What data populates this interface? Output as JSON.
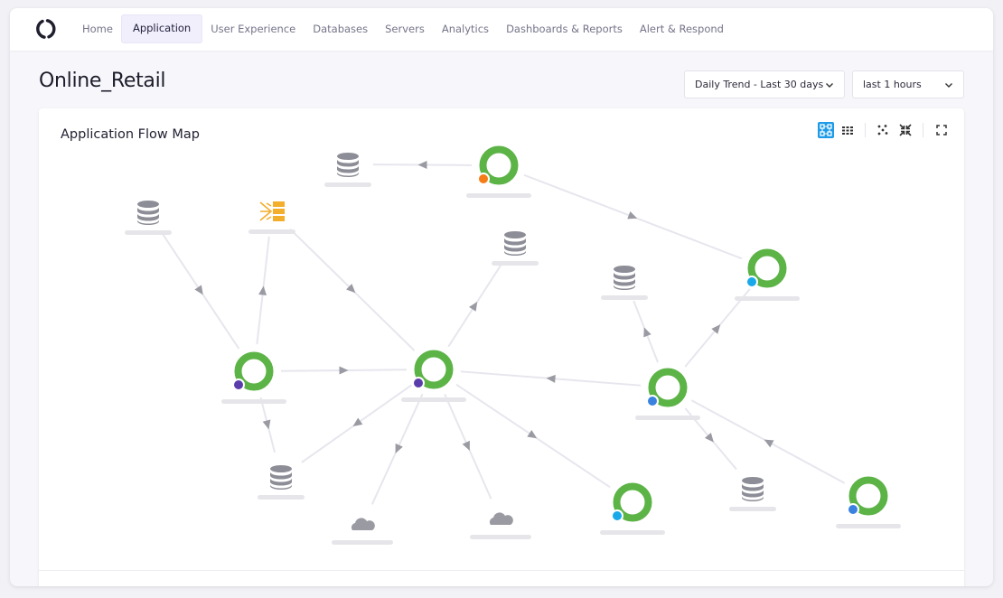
{
  "nav": {
    "items": [
      {
        "label": "Home",
        "active": false
      },
      {
        "label": "Application",
        "active": true
      },
      {
        "label": "User Experience",
        "active": false
      },
      {
        "label": "Databases",
        "active": false
      },
      {
        "label": "Servers",
        "active": false
      },
      {
        "label": "Analytics",
        "active": false
      },
      {
        "label": "Dashboards & Reports",
        "active": false
      },
      {
        "label": "Alert & Respond",
        "active": false
      }
    ]
  },
  "page": {
    "title": "Online_Retail"
  },
  "filters": {
    "trend": {
      "value": "Daily Trend - Last 30 days"
    },
    "range": {
      "value": "last 1 hours"
    }
  },
  "panel": {
    "title": "Application Flow Map",
    "toolbar": [
      "flow-view-icon",
      "grid-view-icon",
      "scatter-icon",
      "collapse-icon",
      "fullscreen-icon"
    ]
  },
  "colors": {
    "accent": "#1e9be8",
    "healthy_ring": "#5cb346",
    "status_purple": "#5a3dab",
    "status_orange": "#f57c16",
    "status_cyan": "#19a8e8",
    "status_blue": "#3b82e0",
    "database": "#8d8d97",
    "cloud": "#9a9aa3",
    "queue": "#f3ae2c"
  },
  "flow_map": {
    "nodes": [
      {
        "id": "app-top",
        "type": "app",
        "status": "orange"
      },
      {
        "id": "app-right-top",
        "type": "app",
        "status": "cyan"
      },
      {
        "id": "app-left",
        "type": "app",
        "status": "purple"
      },
      {
        "id": "app-center",
        "type": "app",
        "status": "purple"
      },
      {
        "id": "app-right",
        "type": "app",
        "status": "blue"
      },
      {
        "id": "app-bottom-mid",
        "type": "app",
        "status": "cyan"
      },
      {
        "id": "app-bottom-right",
        "type": "app",
        "status": "blue"
      },
      {
        "id": "db-top",
        "type": "database"
      },
      {
        "id": "db-left",
        "type": "database"
      },
      {
        "id": "queue-left",
        "type": "queue"
      },
      {
        "id": "db-center",
        "type": "database"
      },
      {
        "id": "db-right-top",
        "type": "database"
      },
      {
        "id": "db-bottom-left",
        "type": "database"
      },
      {
        "id": "db-bottom-right",
        "type": "database"
      },
      {
        "id": "cloud-left",
        "type": "cloud"
      },
      {
        "id": "cloud-right",
        "type": "cloud"
      }
    ],
    "edges": [
      {
        "from": "app-top",
        "to": "db-top"
      },
      {
        "from": "app-top",
        "to": "app-right-top"
      },
      {
        "from": "db-left",
        "to": "app-left"
      },
      {
        "from": "app-left",
        "to": "queue-left"
      },
      {
        "from": "queue-left",
        "to": "app-center"
      },
      {
        "from": "app-center",
        "to": "db-center"
      },
      {
        "from": "app-left",
        "to": "app-center"
      },
      {
        "from": "app-left",
        "to": "db-bottom-left"
      },
      {
        "from": "app-center",
        "to": "db-bottom-left"
      },
      {
        "from": "app-center",
        "to": "cloud-left"
      },
      {
        "from": "app-center",
        "to": "cloud-right"
      },
      {
        "from": "app-center",
        "to": "app-bottom-mid"
      },
      {
        "from": "app-right",
        "to": "app-center"
      },
      {
        "from": "app-right",
        "to": "db-right-top"
      },
      {
        "from": "app-right",
        "to": "app-right-top"
      },
      {
        "from": "app-right",
        "to": "db-bottom-right"
      },
      {
        "from": "app-bottom-right",
        "to": "app-right"
      }
    ]
  }
}
